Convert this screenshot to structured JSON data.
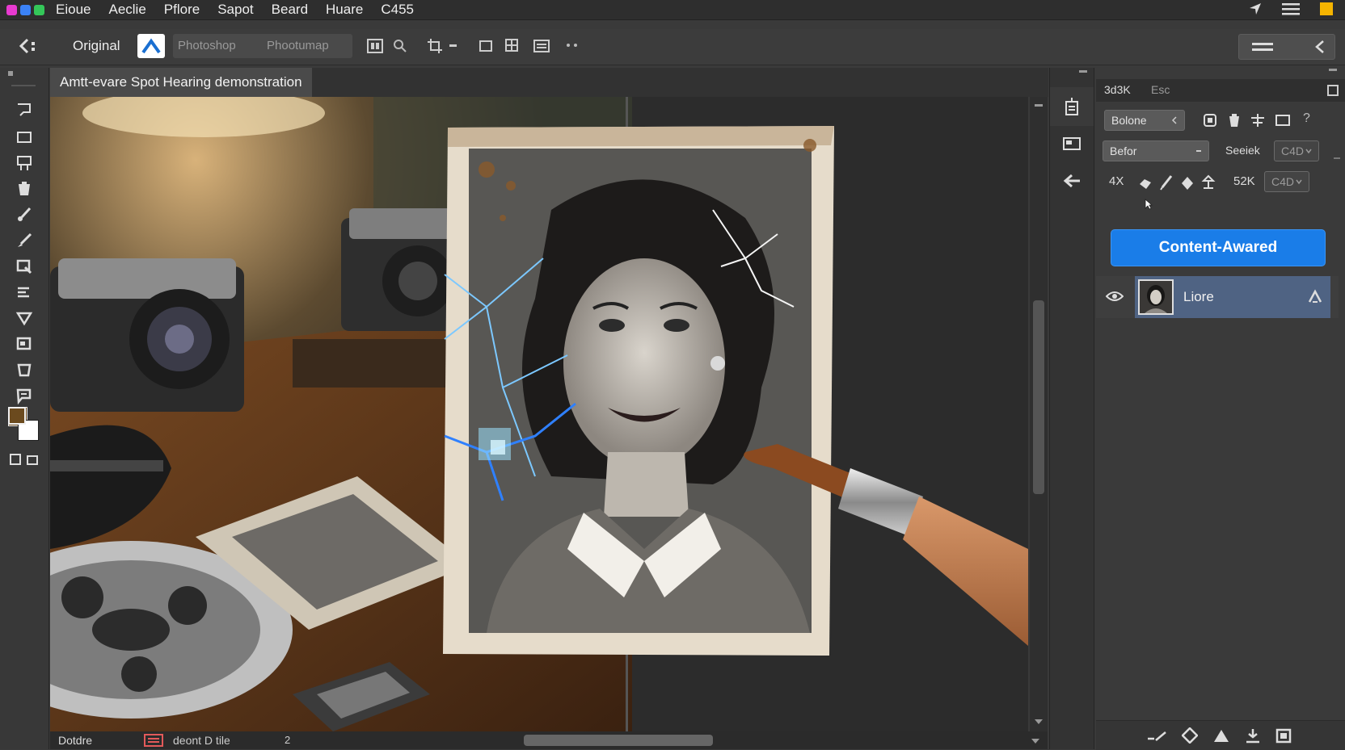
{
  "menubar": {
    "items": [
      "Eioue",
      "Aeclie",
      "Pflore",
      "Sapot",
      "Beard",
      "Huare",
      "C455"
    ]
  },
  "options": {
    "original_label": "Original",
    "tab_photoshop": "Photoshop",
    "tab_photoumap": "Phootumap"
  },
  "document": {
    "tab_title": "Amtt-evare Spot Hearing demonstration"
  },
  "panel": {
    "tab1": "3d3K",
    "tab2": "Esc",
    "blend_dropdown": "Bolone",
    "mode_dropdown": "Befor",
    "search_label": "Seeiek",
    "search_value": "C4D",
    "size_label": "52K",
    "size_value": "C4D",
    "brush_label": "4X",
    "primary_button": "Content-Awared",
    "layer_name": "Liore"
  },
  "statusbar": {
    "left_label": "Dotdre",
    "doc_info": "deont D tile",
    "arrow": "2"
  },
  "colors": {
    "accent": "#1a7de8",
    "foreground_swatch": "#6b4a1e",
    "background_swatch": "#ffffff"
  }
}
